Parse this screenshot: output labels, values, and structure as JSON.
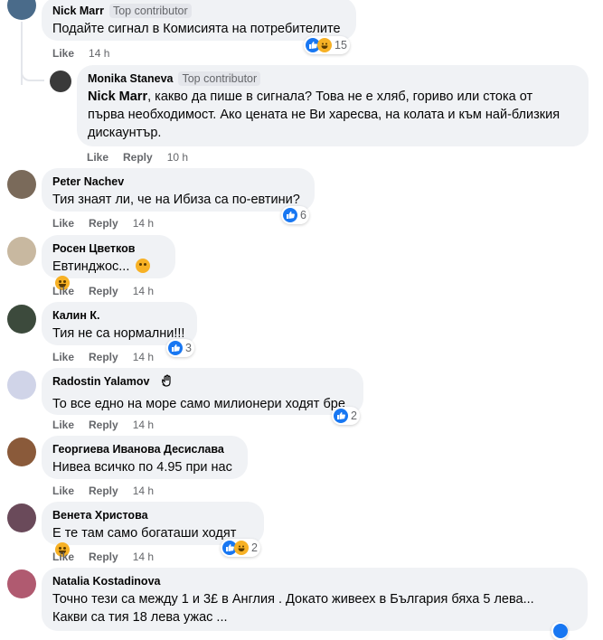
{
  "comments": [
    {
      "author": "Nick Marr",
      "badge": "Top contributor",
      "text": "Подайте сигнал в Комисията на потребителите",
      "actions": {
        "like": "Like",
        "time": "14 h"
      },
      "reactions": "15"
    },
    {
      "author": "Monika Staneva",
      "badge": "Top contributor",
      "mention": "Nick Marr",
      "text_line1": ", какво да пише в сигнала? Това не е хляб, гориво или стока от",
      "text_line2": "първа необходимост. Ако цената не Ви харесва, на колата и към най-близкия",
      "text_line3": "дискаунтър.",
      "actions": {
        "like": "Like",
        "reply": "Reply",
        "time": "10 h"
      }
    },
    {
      "author": "Peter Nachev",
      "text": "Тия знаят ли, че на Ибиза са по-евтини?",
      "actions": {
        "like": "Like",
        "reply": "Reply",
        "time": "14 h"
      },
      "reactions": "6"
    },
    {
      "author": "Росен Цветков",
      "text": "Евтинджос...",
      "actions": {
        "like": "Like",
        "reply": "Reply",
        "time": "14 h"
      }
    },
    {
      "author": "Калин К.",
      "text": "Тия не са нормални!!!",
      "actions": {
        "like": "Like",
        "reply": "Reply",
        "time": "14 h"
      },
      "reactions": "3"
    },
    {
      "author": "Radostin Yalamov",
      "text": "То все едно на море само милионери ходят бре",
      "actions": {
        "like": "Like",
        "reply": "Reply",
        "time": "14 h"
      },
      "reactions": "2"
    },
    {
      "author": "Георгиева Иванова Десислава",
      "text": "Нивеа всичко по 4.95 при нас",
      "actions": {
        "like": "Like",
        "reply": "Reply",
        "time": "14 h"
      }
    },
    {
      "author": "Венета Христова",
      "text": "Е те там само богаташи ходят",
      "actions": {
        "like": "Like",
        "reply": "Reply",
        "time": "14 h"
      },
      "reactions": "2"
    },
    {
      "author": "Natalia Kostadinova",
      "text_line1": "Точно тези са между 1 и 3£ в Англия . Докато живеех в България бяха 5 лева...",
      "text_line2": "Какви са тия 18 лева ужас ..."
    }
  ],
  "colors": {
    "bubble": "#f0f2f5",
    "meta": "#65676b",
    "like": "#1877f2",
    "haha": "#f7b125"
  }
}
